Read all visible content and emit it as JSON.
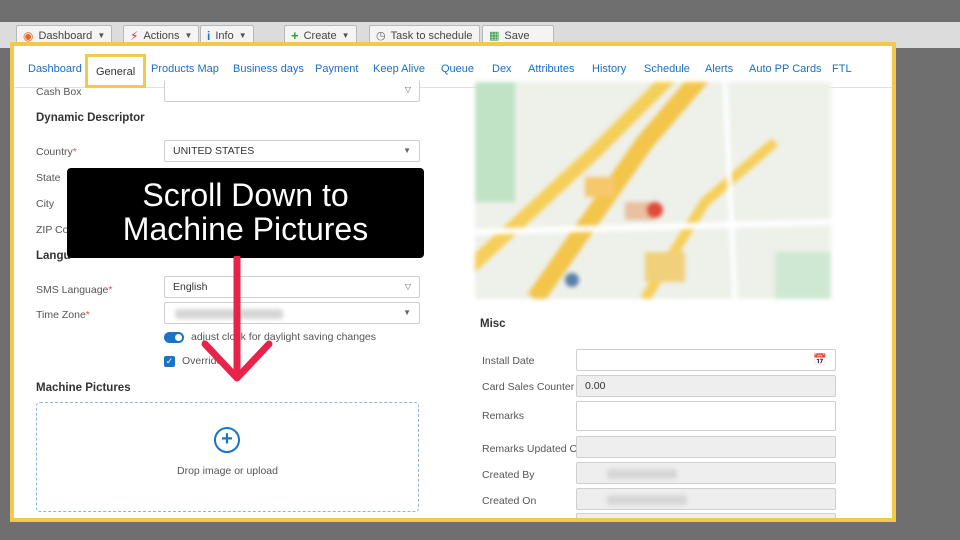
{
  "toolbar": {
    "dashboard": "Dashboard",
    "actions": "Actions",
    "info": "Info",
    "create": "Create",
    "task": "Task to schedule",
    "save": "Save"
  },
  "tabs": [
    "Dashboard",
    "General",
    "Products Map",
    "Business days",
    "Payment",
    "Keep Alive",
    "Queue",
    "Dex",
    "Attributes",
    "History",
    "Schedule",
    "Alerts",
    "Auto PP Cards",
    "FTL"
  ],
  "active_tab": "General",
  "left": {
    "cash_box_label": "Cash Box",
    "dynamic_descriptor": "Dynamic Descriptor",
    "country_label": "Country",
    "country_value": "UNITED STATES",
    "state_label": "State",
    "city_label": "City",
    "zip_label": "ZIP Co",
    "language_section": "Langu",
    "sms_language_label": "SMS Language",
    "sms_language_value": "English",
    "time_zone_label": "Time Zone",
    "adjust_clock": "adjust clock for daylight saving changes",
    "override": "Override",
    "required_mark": "*",
    "machine_pictures": "Machine Pictures",
    "drop_text": "Drop image or upload"
  },
  "callout": {
    "line1": "Scroll Down to",
    "line2": "Machine Pictures"
  },
  "misc": {
    "title": "Misc",
    "install_date": "Install Date",
    "card_sales_counter": "Card Sales Counter",
    "card_sales_value": "0.00",
    "remarks": "Remarks",
    "remarks_updated_on": "Remarks Updated On",
    "created_by": "Created By",
    "created_on": "Created On"
  },
  "colors": {
    "highlight": "#f2c94c",
    "link": "#1a6fc4",
    "arrow": "#e8234a",
    "accent": "#1a73c7"
  },
  "icons": [
    "dashboard-icon",
    "lightning-icon",
    "info-icon",
    "plus-icon",
    "clock-icon",
    "save-icon",
    "calendar-icon",
    "add-circle-icon",
    "down-arrow-icon"
  ]
}
